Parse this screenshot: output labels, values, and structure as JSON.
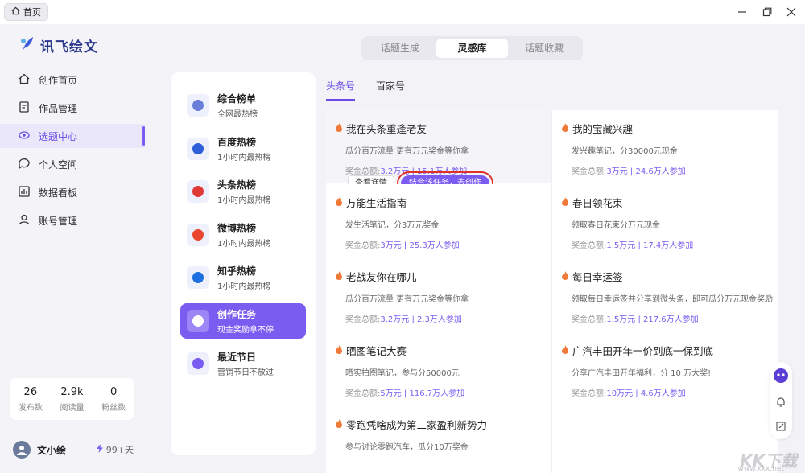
{
  "titlebar": {
    "tab_label": "首页"
  },
  "sidebar": {
    "logo_text": "讯飞绘文",
    "items": [
      {
        "label": "创作首页",
        "icon": "home-icon"
      },
      {
        "label": "作品管理",
        "icon": "document-icon"
      },
      {
        "label": "选题中心",
        "icon": "eye-icon",
        "active": true
      },
      {
        "label": "个人空间",
        "icon": "chat-icon"
      },
      {
        "label": "数据看板",
        "icon": "chart-icon"
      },
      {
        "label": "账号管理",
        "icon": "user-icon"
      }
    ],
    "stats": [
      {
        "num": "26",
        "label": "发布数"
      },
      {
        "num": "2.9k",
        "label": "阅读量"
      },
      {
        "num": "0",
        "label": "粉丝数"
      }
    ],
    "user": {
      "name": "文小绘",
      "days": "99+天"
    }
  },
  "top_tabs": [
    "话题生成",
    "灵感库",
    "话题收藏"
  ],
  "categories": [
    {
      "title": "综合榜单",
      "sub": "全网最热榜",
      "icon": "medal-icon",
      "color": "#6a7fd8"
    },
    {
      "title": "百度热榜",
      "sub": "1小时内最热榜",
      "icon": "baidu-icon",
      "color": "#2f5fd8"
    },
    {
      "title": "头条热榜",
      "sub": "1小时内最热榜",
      "icon": "toutiao-icon",
      "color": "#e03a36"
    },
    {
      "title": "微博热榜",
      "sub": "1小时内最热榜",
      "icon": "weibo-icon",
      "color": "#e8462e"
    },
    {
      "title": "知乎热榜",
      "sub": "1小时内最热榜",
      "icon": "zhihu-icon",
      "color": "#1e6fe0"
    },
    {
      "title": "创作任务",
      "sub": "现金奖励拿不停",
      "icon": "task-icon",
      "color": "#ffffff",
      "active": true
    },
    {
      "title": "最近节日",
      "sub": "营销节日不放过",
      "icon": "balloon-icon",
      "color": "#7b5cf0"
    }
  ],
  "sub_tabs": [
    "头条号",
    "百家号"
  ],
  "cards": [
    {
      "title": "我在头条重逢老友",
      "desc": "瓜分百万流量 更有万元奖金等你拿",
      "meta_label": "奖金总额:",
      "amount": "3.2万元",
      "sep": " | ",
      "count": "15.1万人参加",
      "highlight": true
    },
    {
      "title": "我的宝藏兴趣",
      "desc": "发兴趣笔记，分30000元现金",
      "meta_label": "奖金总额:",
      "amount": "3万元",
      "sep": " | ",
      "count": "24.6万人参加"
    },
    {
      "title": "万能生活指南",
      "desc": "发生活笔记，分3万元奖金",
      "meta_label": "奖金总额:",
      "amount": "3万元",
      "sep": " | ",
      "count": "25.3万人参加"
    },
    {
      "title": "春日领花束",
      "desc": "领取春日花束分万元现金",
      "meta_label": "奖金总额:",
      "amount": "1.5万元",
      "sep": " | ",
      "count": "17.4万人参加"
    },
    {
      "title": "老战友你在哪儿",
      "desc": "瓜分百万流量 更有万元奖金等你拿",
      "meta_label": "奖金总额:",
      "amount": "3.2万元",
      "sep": " | ",
      "count": "2.3万人参加"
    },
    {
      "title": "每日幸运签",
      "desc": "领取每日幸运签并分享到微头条，即可瓜分万元现金奖励",
      "meta_label": "奖金总额:",
      "amount": "1.5万元",
      "sep": " | ",
      "count": "217.6万人参加"
    },
    {
      "title": "晒图笔记大赛",
      "desc": "晒实拍图笔记，参与分50000元",
      "meta_label": "奖金总额:",
      "amount": "5万元",
      "sep": " | ",
      "count": "116.7万人参加"
    },
    {
      "title": "广汽丰田开年一价到底一保到底",
      "desc": "分享广汽丰田开年福利，分 10 万大奖!",
      "meta_label": "奖金总额:",
      "amount": "10万元",
      "sep": " | ",
      "count": "4.6万人参加"
    },
    {
      "title": "零跑凭啥成为第二家盈利新势力",
      "desc": "参与讨论零跑汽车，瓜分10万奖金",
      "meta_label": "",
      "amount": "",
      "sep": "",
      "count": ""
    }
  ],
  "card_actions": {
    "detail": "查看详情",
    "create": "结合该任务，去创作"
  },
  "watermark": {
    "main": "KK下载",
    "url": "www.kkx.net"
  }
}
